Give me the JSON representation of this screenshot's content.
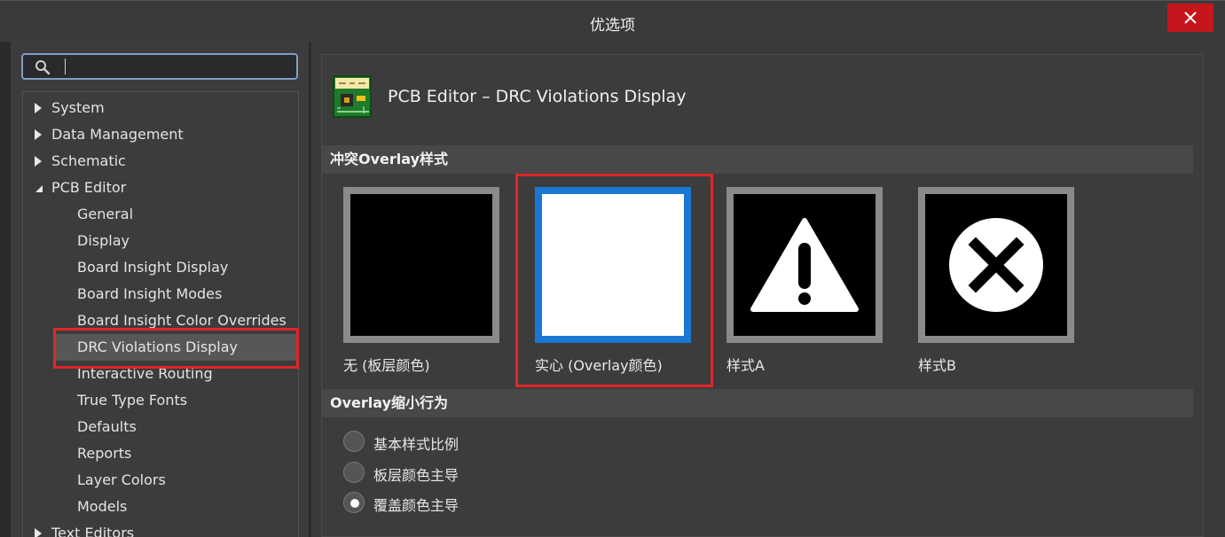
{
  "window": {
    "title": "优选项",
    "close_label": "close"
  },
  "search": {
    "value": "",
    "placeholder": ""
  },
  "tree": {
    "items": [
      {
        "label": "System",
        "level": 0,
        "expanded": false
      },
      {
        "label": "Data Management",
        "level": 0,
        "expanded": false
      },
      {
        "label": "Schematic",
        "level": 0,
        "expanded": false
      },
      {
        "label": "PCB Editor",
        "level": 0,
        "expanded": true
      },
      {
        "label": "General",
        "level": 1
      },
      {
        "label": "Display",
        "level": 1
      },
      {
        "label": "Board Insight Display",
        "level": 1
      },
      {
        "label": "Board Insight Modes",
        "level": 1
      },
      {
        "label": "Board Insight Color Overrides",
        "level": 1
      },
      {
        "label": "DRC Violations Display",
        "level": 1,
        "selected": true
      },
      {
        "label": "Interactive Routing",
        "level": 1
      },
      {
        "label": "True Type Fonts",
        "level": 1
      },
      {
        "label": "Defaults",
        "level": 1
      },
      {
        "label": "Reports",
        "level": 1
      },
      {
        "label": "Layer Colors",
        "level": 1
      },
      {
        "label": "Models",
        "level": 1
      },
      {
        "label": "Text Editors",
        "level": 0,
        "expanded": false
      }
    ]
  },
  "page": {
    "title": "PCB Editor – DRC Violations Display",
    "icon": "pcb-board-icon"
  },
  "overlay_style": {
    "header": "冲突Overlay样式",
    "options": [
      {
        "label": "无 (板层颜色)",
        "icon": "none-black-swatch",
        "selected": false
      },
      {
        "label": "实心 (Overlay颜色)",
        "icon": "solid-white-swatch",
        "selected": true
      },
      {
        "label": "样式A",
        "icon": "warning-triangle-icon",
        "selected": false
      },
      {
        "label": "样式B",
        "icon": "circle-x-icon",
        "selected": false
      }
    ]
  },
  "overlay_shrink": {
    "header": "Overlay缩小行为",
    "options": [
      {
        "label": "基本样式比例",
        "selected": false
      },
      {
        "label": "板层颜色主导",
        "selected": false
      },
      {
        "label": "覆盖颜色主导",
        "selected": true
      }
    ]
  },
  "colors": {
    "accent": "#1a78d2",
    "highlight_box": "#e0252a",
    "close_button": "#c4161c"
  }
}
